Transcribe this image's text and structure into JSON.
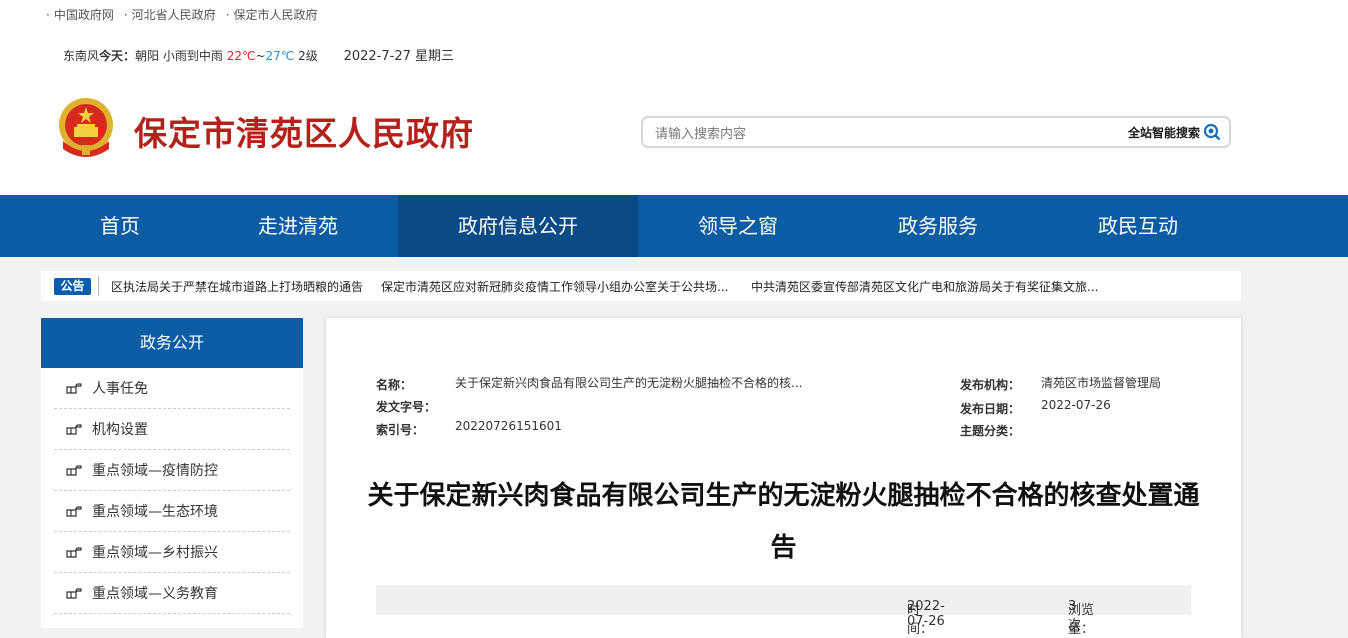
{
  "top_links": [
    "中国政府网",
    "河北省人民政府",
    "保定市人民政府"
  ],
  "weather": {
    "wind": "东南风",
    "today_label": "今天：",
    "city": "朝阳",
    "desc": "小雨到中雨",
    "high": "22℃",
    "tilde": "~",
    "low": "27℃",
    "level": "2级",
    "date": "2022-7-27 星期三"
  },
  "site": {
    "title": "保定市清苑区人民政府"
  },
  "search": {
    "placeholder": "请输入搜索内容",
    "button_label": "全站智能搜索"
  },
  "nav": [
    "首页",
    "走进清苑",
    "政府信息公开",
    "领导之窗",
    "政务服务",
    "政民互动"
  ],
  "nav_active_index": 2,
  "notice": {
    "badge": "公告",
    "items": [
      "区执法局关于严禁在城市道路上打场晒粮的通告",
      "保定市清苑区应对新冠肺炎疫情工作领导小组办公室关于公共场...",
      "中共清苑区委宣传部清苑区文化广电和旅游局关于有奖征集文旅..."
    ]
  },
  "sidebar": {
    "title": "政务公开",
    "items": [
      "人事任免",
      "机构设置",
      "重点领域—疫情防控",
      "重点领域—生态环境",
      "重点领域—乡村振兴",
      "重点领域—义务教育"
    ]
  },
  "meta": {
    "name_label": "名称：",
    "name_value": "关于保定新兴肉食品有限公司生产的无淀粉火腿抽检不合格的核...",
    "doc_no_label": "发文字号：",
    "doc_no_value": "",
    "index_label": "索引号：",
    "index_value": "20220726151601",
    "org_label": "发布机构：",
    "org_value": "清苑区市场监督管理局",
    "date_label": "发布日期：",
    "date_value": "2022-07-26",
    "topic_label": "主题分类：",
    "topic_value": ""
  },
  "article": {
    "title": "关于保定新兴肉食品有限公司生产的无淀粉火腿抽检不合格的核查处置通告",
    "time_label": "时间：",
    "time_value": "2022-07-26",
    "views_label": "浏览量：",
    "views_value": "3次"
  },
  "colors": {
    "brand_blue": "#0b5ca3",
    "active_blue": "#0a4a86",
    "title_red": "#b3221a"
  }
}
